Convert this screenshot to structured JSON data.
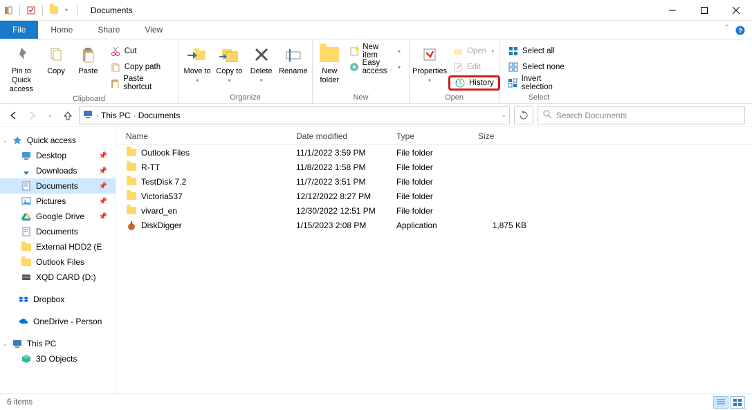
{
  "window": {
    "title": "Documents"
  },
  "tabs": {
    "file": "File",
    "home": "Home",
    "share": "Share",
    "view": "View"
  },
  "ribbon": {
    "clipboard": {
      "label": "Clipboard",
      "pin": "Pin to Quick access",
      "copy": "Copy",
      "paste": "Paste",
      "cut": "Cut",
      "copy_path": "Copy path",
      "paste_shortcut": "Paste shortcut"
    },
    "organize": {
      "label": "Organize",
      "move_to": "Move to",
      "copy_to": "Copy to",
      "delete": "Delete",
      "rename": "Rename"
    },
    "new": {
      "label": "New",
      "new_folder": "New folder",
      "new_item": "New item",
      "easy_access": "Easy access"
    },
    "open": {
      "label": "Open",
      "properties": "Properties",
      "open": "Open",
      "edit": "Edit",
      "history": "History"
    },
    "select": {
      "label": "Select",
      "select_all": "Select all",
      "select_none": "Select none",
      "invert": "Invert selection"
    }
  },
  "address": {
    "crumbs": [
      "This PC",
      "Documents"
    ]
  },
  "search": {
    "placeholder": "Search Documents"
  },
  "sidebar": {
    "quick_access": "Quick access",
    "items": [
      {
        "label": "Desktop",
        "pin": true
      },
      {
        "label": "Downloads",
        "pin": true
      },
      {
        "label": "Documents",
        "pin": true,
        "selected": true
      },
      {
        "label": "Pictures",
        "pin": true
      },
      {
        "label": "Google Drive",
        "pin": true
      },
      {
        "label": "Documents"
      },
      {
        "label": "External HDD2 (E"
      },
      {
        "label": "Outlook Files"
      },
      {
        "label": "XQD CARD (D:)"
      }
    ],
    "dropbox": "Dropbox",
    "onedrive": "OneDrive - Person",
    "this_pc": "This PC",
    "objects3d": "3D Objects"
  },
  "columns": {
    "name": "Name",
    "date": "Date modified",
    "type": "Type",
    "size": "Size"
  },
  "rows": [
    {
      "icon": "folder",
      "name": "Outlook Files",
      "date": "11/1/2022 3:59 PM",
      "type": "File folder",
      "size": ""
    },
    {
      "icon": "folder",
      "name": "R-TT",
      "date": "11/8/2022 1:58 PM",
      "type": "File folder",
      "size": ""
    },
    {
      "icon": "folder",
      "name": "TestDisk 7.2",
      "date": "11/7/2022 3:51 PM",
      "type": "File folder",
      "size": ""
    },
    {
      "icon": "folder",
      "name": "Victoria537",
      "date": "12/12/2022 8:27 PM",
      "type": "File folder",
      "size": ""
    },
    {
      "icon": "folder",
      "name": "vivard_en",
      "date": "12/30/2022 12:51 PM",
      "type": "File folder",
      "size": ""
    },
    {
      "icon": "app",
      "name": "DiskDigger",
      "date": "1/15/2023 2:08 PM",
      "type": "Application",
      "size": "1,875 KB"
    }
  ],
  "status": {
    "items": "6 items"
  }
}
